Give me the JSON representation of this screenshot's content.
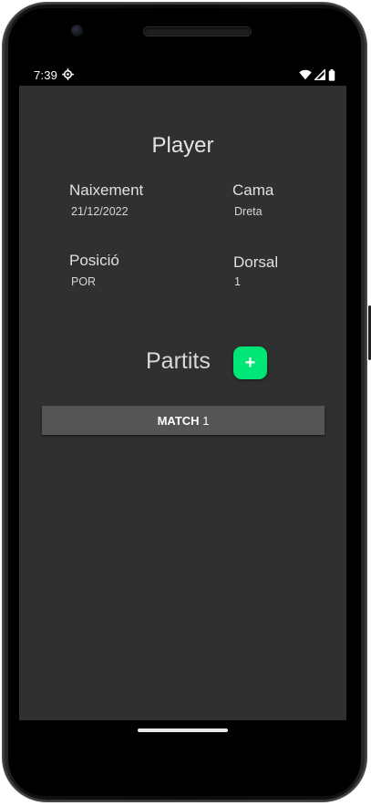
{
  "status_bar": {
    "time": "7:39",
    "icons": [
      "settings-gear-icon",
      "wifi-icon",
      "cell-signal-icon",
      "battery-icon"
    ]
  },
  "player": {
    "title": "Player",
    "birth_label": "Naixement",
    "birth_value": "21/12/2022",
    "leg_label": "Cama",
    "leg_value": "Dreta",
    "position_label": "Posició",
    "position_value": "POR",
    "number_label": "Dorsal",
    "number_value": "1"
  },
  "matches": {
    "title": "Partits",
    "add_label": "+",
    "items": [
      {
        "prefix": "MATCH",
        "number": "1"
      }
    ]
  },
  "colors": {
    "background": "#303030",
    "accent": "#00e676",
    "match_button": "#555555"
  }
}
